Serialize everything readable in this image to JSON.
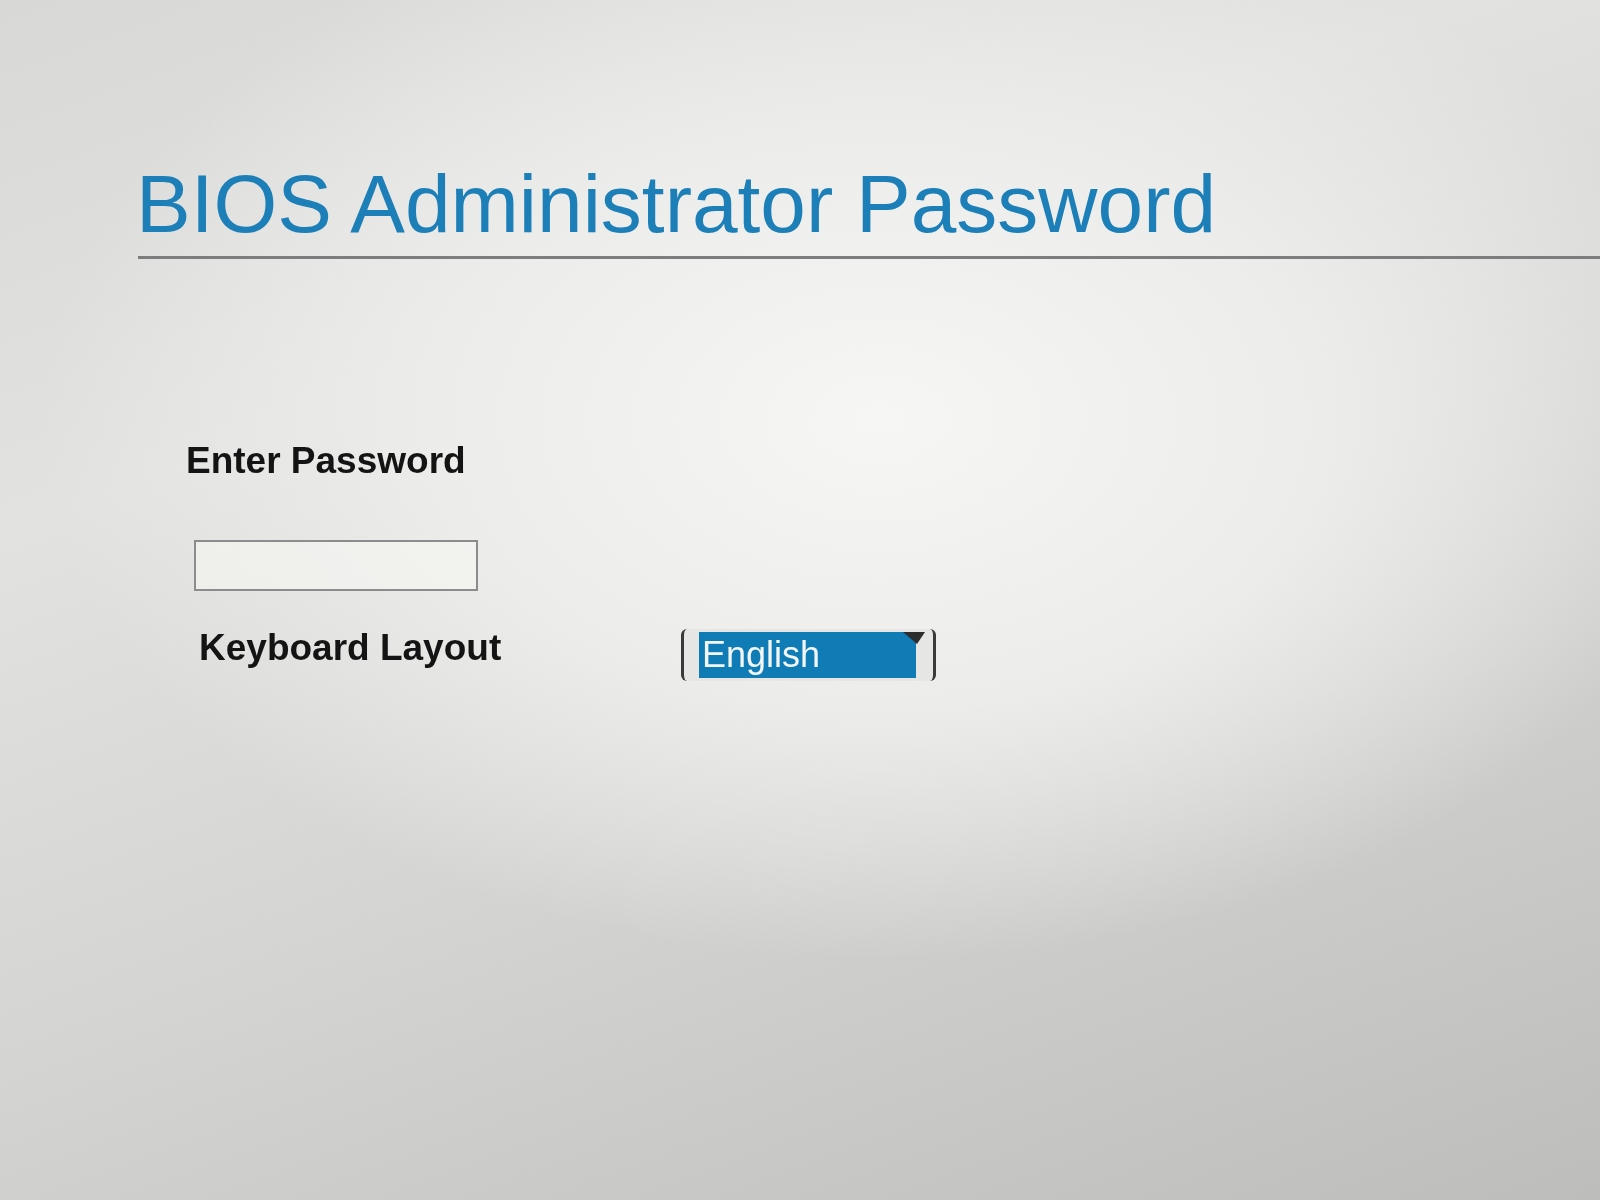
{
  "title": "BIOS Administrator Password",
  "password": {
    "label": "Enter Password",
    "focused": false
  },
  "keyboard_layout": {
    "label": "Keyboard Layout",
    "value": "English",
    "focused": true
  }
}
